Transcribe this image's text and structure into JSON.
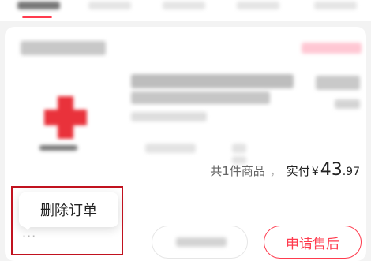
{
  "tabs": [
    {
      "id": "all",
      "active": true
    },
    {
      "id": "tab2",
      "active": false
    },
    {
      "id": "tab3",
      "active": false
    },
    {
      "id": "tab4",
      "active": false
    },
    {
      "id": "tab5",
      "active": false
    }
  ],
  "order": {
    "summary": {
      "count_text": "共1件商品",
      "separator": "，",
      "paid_label": "实付",
      "currency": "¥",
      "amount_int": "43",
      "amount_dec": ".97"
    },
    "actions": {
      "after_sale_label": "申请售后"
    },
    "more_menu": {
      "dots": "···",
      "delete_order_label": "删除订单"
    }
  },
  "colors": {
    "accent": "#ff3b4e",
    "highlight_border": "#c1121f"
  }
}
